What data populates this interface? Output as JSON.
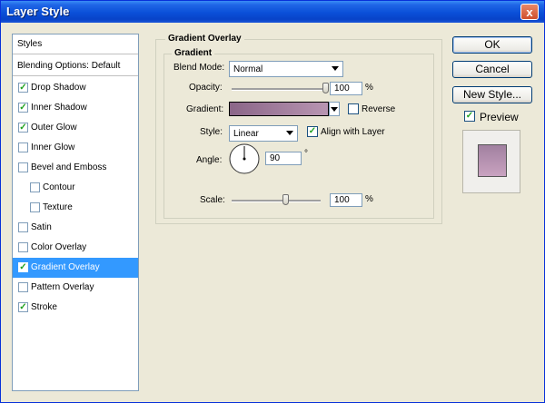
{
  "window": {
    "title": "Layer Style",
    "close_glyph": "x"
  },
  "sidebar": {
    "items": [
      {
        "label": "Styles",
        "checkbox": false
      },
      {
        "label": "Blending Options: Default",
        "checkbox": false
      },
      {
        "label": "Drop Shadow",
        "checkbox": true,
        "checked": true
      },
      {
        "label": "Inner Shadow",
        "checkbox": true,
        "checked": true
      },
      {
        "label": "Outer Glow",
        "checkbox": true,
        "checked": true
      },
      {
        "label": "Inner Glow",
        "checkbox": true,
        "checked": false
      },
      {
        "label": "Bevel and Emboss",
        "checkbox": true,
        "checked": false
      },
      {
        "label": "Contour",
        "checkbox": true,
        "checked": false
      },
      {
        "label": "Texture",
        "checkbox": true,
        "checked": false
      },
      {
        "label": "Satin",
        "checkbox": true,
        "checked": false
      },
      {
        "label": "Color Overlay",
        "checkbox": true,
        "checked": false
      },
      {
        "label": "Gradient Overlay",
        "checkbox": true,
        "checked": true,
        "selected": true
      },
      {
        "label": "Pattern Overlay",
        "checkbox": true,
        "checked": false
      },
      {
        "label": "Stroke",
        "checkbox": true,
        "checked": true
      }
    ]
  },
  "panel": {
    "section_title": "Gradient Overlay",
    "subsection_title": "Gradient",
    "blend_mode": {
      "label": "Blend Mode:",
      "value": "Normal"
    },
    "opacity": {
      "label": "Opacity:",
      "value": "100",
      "unit": "%",
      "level": 100
    },
    "gradient": {
      "label": "Gradient:",
      "colors": [
        "#8b6688",
        "#b895b2"
      ]
    },
    "reverse": {
      "label": "Reverse",
      "checked": false
    },
    "style": {
      "label": "Style:",
      "value": "Linear"
    },
    "align": {
      "label": "Align with Layer",
      "checked": true
    },
    "angle": {
      "label": "Angle:",
      "value": "90",
      "unit": "°"
    },
    "scale": {
      "label": "Scale:",
      "value": "100",
      "unit": "%",
      "level": 100
    }
  },
  "buttons": {
    "ok": "OK",
    "cancel": "Cancel",
    "new_style": "New Style...",
    "preview": "Preview",
    "preview_checked": true
  },
  "colors": {
    "accent": "#3399ff",
    "preview_swatch_top": "#a180a0",
    "preview_swatch_bottom": "#c9a2c0",
    "check": "#21a121"
  }
}
